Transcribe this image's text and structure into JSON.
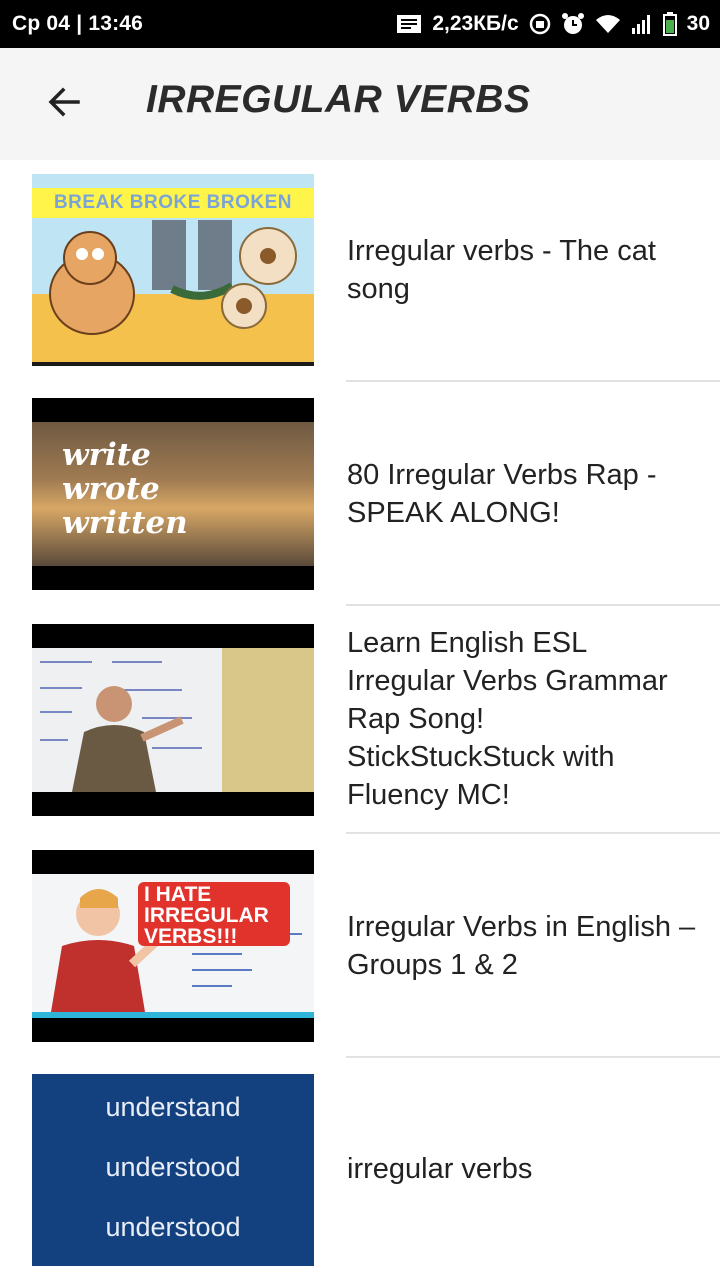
{
  "status_bar": {
    "datetime": "Ср 04 | 13:46",
    "network_speed": "2,23КБ/с",
    "battery": "30",
    "icons": [
      "notification-icon",
      "sync-icon",
      "alarm-icon",
      "wifi-icon",
      "signal-icon",
      "battery-icon"
    ]
  },
  "app_bar": {
    "title": "IRREGULAR VERBS",
    "back_icon": "arrow-back-icon"
  },
  "videos": [
    {
      "title": "Irregular verbs - The cat song",
      "thumbnail_text": "BREAK BROKE BROKEN"
    },
    {
      "title": "80 Irregular Verbs Rap - SPEAK ALONG!",
      "thumbnail_text": [
        "write",
        "wrote",
        "written"
      ]
    },
    {
      "title": "Learn English ESL Irregular Verbs Grammar Rap Song! StickStuckStuck with Fluency MC!"
    },
    {
      "title": "Irregular Verbs in English – Groups 1 & 2",
      "thumbnail_text": "I HATE IRREGULAR VERBS!!!"
    },
    {
      "title": "irregular verbs",
      "thumbnail_text": [
        "understand",
        "understood",
        "understood"
      ]
    }
  ],
  "colors": {
    "status_bar_bg": "#000000",
    "app_bar_bg": "#f5f5f5",
    "title_text": "#2b2b2b",
    "list_text": "#222222",
    "divider": "#e2e2e2"
  }
}
